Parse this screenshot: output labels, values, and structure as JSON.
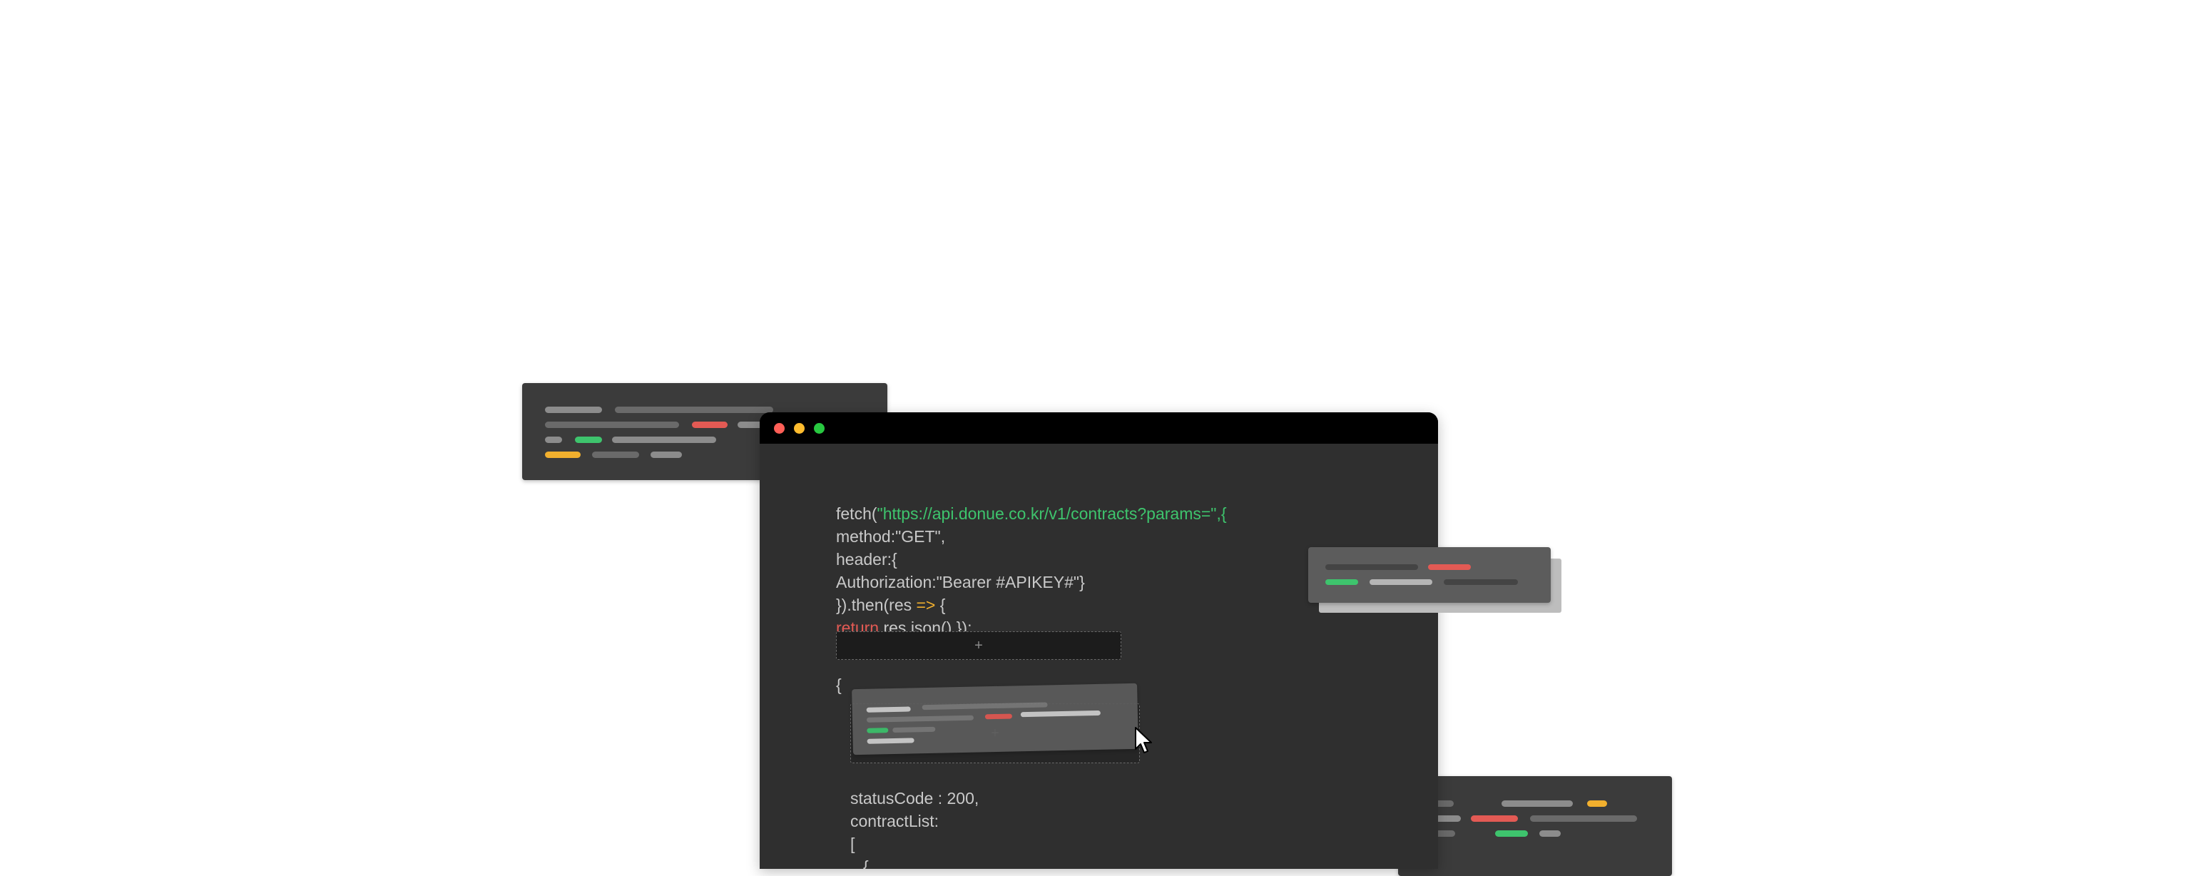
{
  "window": {
    "traffic_lights": [
      {
        "name": "close",
        "color": "#ff5f57"
      },
      {
        "name": "minimize",
        "color": "#febc2e"
      },
      {
        "name": "maximize",
        "color": "#28c840"
      }
    ],
    "code_lines": {
      "line1_fn": "fetch(",
      "line1_url": "\"https://api.donue.co.kr/v1/contracts?params=\",{",
      "line2": "method:\"GET\",",
      "line3": "header:{",
      "line4": "Authorization:\"Bearer #APIKEY#\"}",
      "line5_a": "}).then(res ",
      "line5_arrow": "=>",
      "line5_b": " {",
      "line6_kw": "return",
      "line6_b": " res.json() });"
    },
    "dropzone_plus": "+",
    "json_open": "{",
    "drop_target_plus": "+",
    "response_lines": {
      "status": "statusCode : 200,",
      "list": "contractList:",
      "bracket": "[",
      "brace": "{"
    }
  },
  "colors": {
    "string": "#3ec46d",
    "keyword": "#e35a54",
    "arrow": "#f2b02e",
    "window_bg": "#2f2f2f",
    "titlebar": "#000000"
  }
}
